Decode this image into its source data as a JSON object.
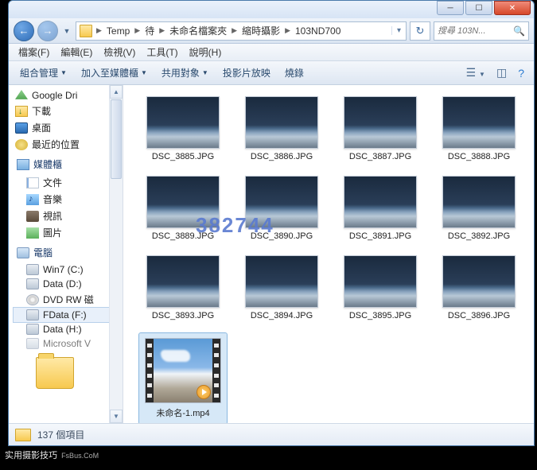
{
  "breadcrumbs": [
    "Temp",
    "待",
    "未命名檔案夾",
    "縮時攝影",
    "103ND700"
  ],
  "search_placeholder": "搜尋 103N...",
  "menu": {
    "file": "檔案(F)",
    "edit": "編輯(E)",
    "view": "檢視(V)",
    "tools": "工具(T)",
    "help": "說明(H)"
  },
  "toolbar": {
    "organize": "組合管理",
    "addlib": "加入至媒體櫃",
    "share": "共用對象",
    "slideshow": "投影片放映",
    "burn": "燒錄"
  },
  "sidebar": {
    "fav": {
      "gdrive": "Google Dri",
      "downloads": "下載",
      "desktop": "桌面",
      "recent": "最近的位置"
    },
    "lib": {
      "header": "媒體櫃",
      "docs": "文件",
      "music": "音樂",
      "video": "視訊",
      "pics": "圖片"
    },
    "pc": {
      "header": "電腦",
      "c": "Win7 (C:)",
      "d": "Data (D:)",
      "dvd": "DVD RW 磁",
      "f": "FData (F:)",
      "h": "Data (H:)",
      "other": "Microsoft V"
    }
  },
  "files": [
    {
      "name": "DSC_3885.JPG"
    },
    {
      "name": "DSC_3886.JPG"
    },
    {
      "name": "DSC_3887.JPG"
    },
    {
      "name": "DSC_3888.JPG"
    },
    {
      "name": "DSC_3889.JPG"
    },
    {
      "name": "DSC_3890.JPG"
    },
    {
      "name": "DSC_3891.JPG"
    },
    {
      "name": "DSC_3892.JPG"
    },
    {
      "name": "DSC_3893.JPG"
    },
    {
      "name": "DSC_3894.JPG"
    },
    {
      "name": "DSC_3895.JPG"
    },
    {
      "name": "DSC_3896.JPG"
    }
  ],
  "video_file": "未命名-1.mp4",
  "status": "137 個項目",
  "watermark": {
    "main": "实用摄影技巧",
    "sub": "FsBus.CoM"
  },
  "center_wm": "382744"
}
